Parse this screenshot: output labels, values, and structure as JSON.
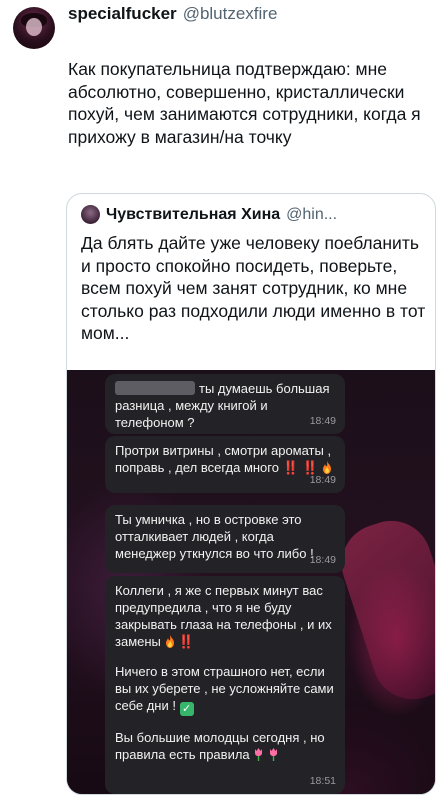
{
  "tweet": {
    "author_name": "specialfucker",
    "author_handle": "@blutzexfire",
    "text": "Как покупательница подтверждаю: мне абсолютно, совершенно, кристаллически похуй, чем занимаются сотрудники, когда я прихожу в магазин/на точку"
  },
  "quote": {
    "author_name": "Чувствительная Хина",
    "author_handle": "@hin...",
    "text": "Да блять дайте уже человеку поебланить и просто спокойно посидеть, поверьте, всем похуй чем занят сотрудник, ко мне столько раз подходили люди именно в тот мом..."
  },
  "chat": {
    "bubbles": [
      {
        "text": "ты думаешь большая разница , между книгой и телефоном ?",
        "time": "18:49"
      },
      {
        "text": "Протри витрины , смотри ароматы , поправь , дел всегда много",
        "bangs": "‼️ ‼️",
        "time": "18:49"
      },
      {
        "text": "Ты умничка , но в островке это отталкивает людей , когда менеджер уткнулся во что либо !",
        "time": "18:49"
      },
      {
        "p1": "Коллеги , я же с первых минут вас предупредила , что я не буду закрывать глаза на телефоны , и их замены",
        "p1_bang": "‼️",
        "p2": "Ничего в этом страшного нет, если вы их уберете , не усложняйте сами себе дни !",
        "check": "✓",
        "p3": "Вы большие молодцы сегодня , но правила есть правила",
        "time": "18:51"
      }
    ]
  },
  "icons": {
    "fire": "fire-icon",
    "double-exclamation": "double-exclamation-icon",
    "check": "check-icon",
    "tulip": "tulip-icon"
  }
}
